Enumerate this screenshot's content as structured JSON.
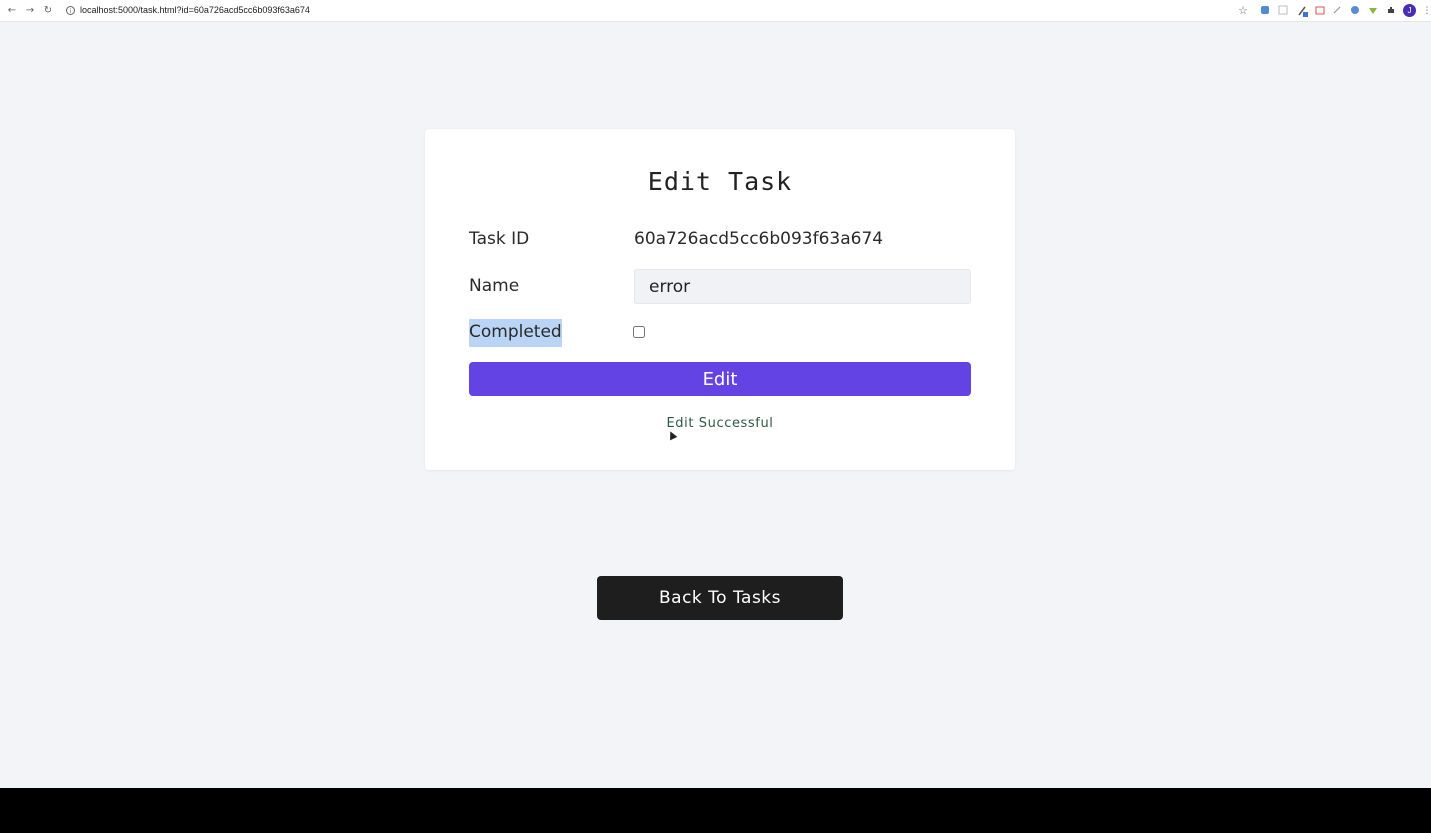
{
  "browser": {
    "url": "localhost:5000/task.html?id=60a726acd5cc6b093f63a674",
    "back_icon": "←",
    "forward_icon": "→",
    "reload_icon": "↻",
    "info_icon": "i",
    "bookmark_icon": "☆",
    "profile_initial": "J",
    "menu_icon": "⋮"
  },
  "card": {
    "title": "Edit Task",
    "task_id_label": "Task ID",
    "task_id_value": "60a726acd5cc6b093f63a674",
    "name_label": "Name",
    "name_value": "error",
    "completed_label": "Completed",
    "edit_button_label": "Edit",
    "status_message": "Edit Successful"
  },
  "back_button_label": "Back To Tasks",
  "colors": {
    "accent": "#6443e4",
    "background": "#f3f4f8",
    "dark_button": "#1e1e1e",
    "success_text": "#2d5a45"
  }
}
